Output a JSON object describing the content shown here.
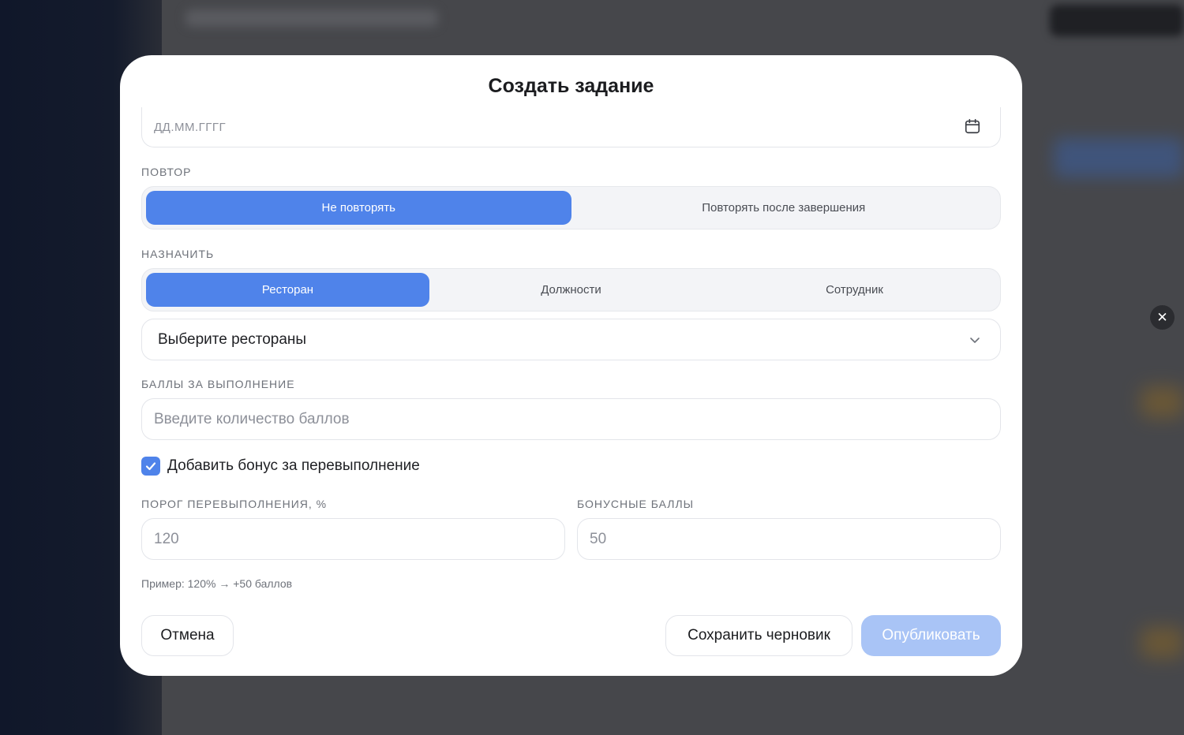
{
  "modal": {
    "title": "Создать задание",
    "close_symbol": "✕"
  },
  "date": {
    "placeholder": "ДД.ММ.ГГГГ",
    "icon": "calendar-icon"
  },
  "repeat": {
    "label": "ПОВТОР",
    "options": [
      "Не повторять",
      "Повторять после завершения"
    ],
    "selected": 0
  },
  "assign": {
    "label": "НАЗНАЧИТЬ",
    "options": [
      "Ресторан",
      "Должности",
      "Сотрудник"
    ],
    "selected": 0,
    "select_placeholder": "Выберите рестораны"
  },
  "points": {
    "label": "БАЛЛЫ ЗА ВЫПОЛНЕНИЕ",
    "placeholder": "Введите количество баллов"
  },
  "bonus": {
    "checkbox_label": "Добавить бонус за перевыполнение",
    "checked": true,
    "threshold_label": "ПОРОГ ПЕРЕВЫПОЛНЕНИЯ, %",
    "threshold_placeholder": "120",
    "bonus_label": "БОНУСНЫЕ БАЛЛЫ",
    "bonus_placeholder": "50",
    "hint": "Пример: 120% → +50 баллов"
  },
  "actions": {
    "cancel": "Отмена",
    "save_draft": "Сохранить черновик",
    "publish": "Опубликовать"
  },
  "colors": {
    "accent": "#4f83ea",
    "accent_disabled": "#a9c4f6"
  }
}
